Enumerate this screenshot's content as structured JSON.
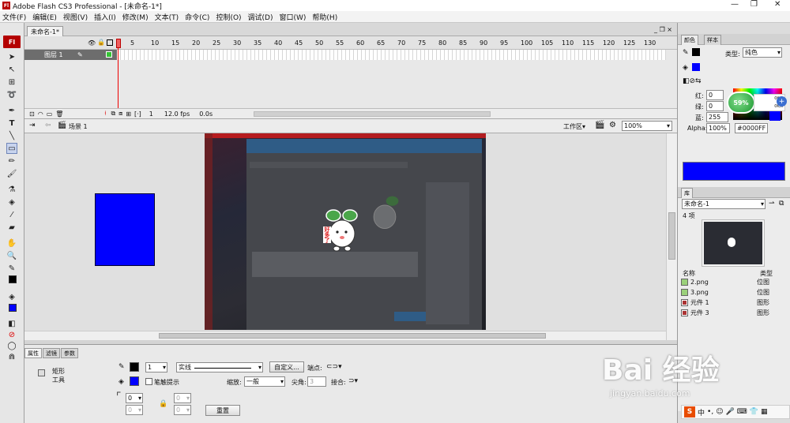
{
  "app": {
    "title": "Adobe Flash CS3 Professional - [未命名-1*]",
    "logo_text": "Fl",
    "window_controls": [
      "—",
      "❐",
      "✕"
    ]
  },
  "menu": [
    "文件(F)",
    "编辑(E)",
    "视图(V)",
    "插入(I)",
    "修改(M)",
    "文本(T)",
    "命令(C)",
    "控制(O)",
    "调试(D)",
    "窗口(W)",
    "帮助(H)"
  ],
  "document": {
    "tab_label": "未命名-1*",
    "tab_controls": "_ ❐ ×"
  },
  "timeline": {
    "frame_numbers": [
      "5",
      "10",
      "15",
      "20",
      "25",
      "30",
      "35",
      "40",
      "45",
      "50",
      "55",
      "60",
      "65",
      "70",
      "75",
      "80",
      "85",
      "90",
      "95",
      "100",
      "105",
      "110",
      "115",
      "120",
      "125",
      "130"
    ],
    "layer_name": "图层 1",
    "current_frame": "1",
    "fps": "12.0 fps",
    "time": "0.0s"
  },
  "scene": {
    "scene_name": "场景 1",
    "workspace_label": "工作区▾",
    "zoom": "100%"
  },
  "properties": {
    "tabs": [
      "属性",
      "滤镜",
      "参数"
    ],
    "tool_name_line1": "矩形",
    "tool_name_line2": "工具",
    "stroke_height": "1",
    "stroke_style": "实线",
    "custom_button": "自定义...",
    "cap_label": "端点:",
    "hinting_label": "笔触提示",
    "scale_label": "缩放:",
    "scale_value": "一般",
    "miter_label": "尖角:",
    "miter_value": "3",
    "join_label": "接合:",
    "corner_value": "0",
    "reset_button": "重置",
    "fill_color": "#0000ff",
    "stroke_color": "#000000"
  },
  "color_panel": {
    "tabs": [
      "颜色",
      "样本"
    ],
    "type_label": "类型:",
    "type_value": "纯色",
    "red_label": "红:",
    "red_value": "0",
    "green_label": "绿:",
    "green_value": "0",
    "blue_label": "蓝:",
    "blue_value": "255",
    "alpha_label": "Alpha:",
    "alpha_value": "100%",
    "hex_value": "#0000FF",
    "swatch_color": "#0000ff",
    "net_percent": "59%",
    "net_up": "0K/s",
    "net_down": "0K/s"
  },
  "library_panel": {
    "tab": "库",
    "doc_select": "未命名-1",
    "item_count": "4 项",
    "col_name": "名称",
    "col_type": "类型",
    "items": [
      {
        "name": "2.png",
        "type": "位图",
        "kind": "bitmap"
      },
      {
        "name": "3.png",
        "type": "位图",
        "kind": "bitmap"
      },
      {
        "name": "元件 1",
        "type": "图形",
        "kind": "symbol"
      },
      {
        "name": "元件 3",
        "type": "图形",
        "kind": "symbol"
      }
    ]
  },
  "stage": {
    "rect_color": "#0000ff",
    "mascot_text": "好多了"
  },
  "watermark": {
    "main": "Bai 经验",
    "url": "jingyan.baidu.com"
  },
  "ime": {
    "logo": "S",
    "lang": "中"
  }
}
